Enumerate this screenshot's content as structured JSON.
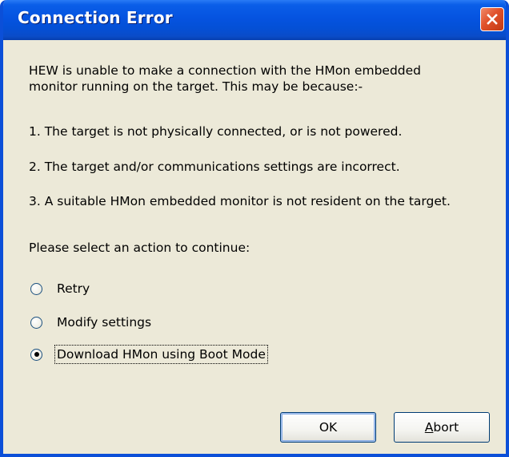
{
  "window": {
    "title": "Connection Error",
    "close_icon": "close-icon"
  },
  "message": {
    "intro_line1": "HEW is unable to make a connection with the HMon embedded",
    "intro_line2": "monitor running on the target. This may be because:-",
    "reason1": "1.  The target is not physically connected, or is not powered.",
    "reason2": "2.  The target and/or communications settings are incorrect.",
    "reason3": "3.  A suitable HMon embedded monitor is not resident on the target.",
    "prompt": "Please select an action to continue:"
  },
  "options": [
    {
      "label": "Retry",
      "checked": false
    },
    {
      "label": "Modify settings",
      "checked": false
    },
    {
      "label": "Download HMon using Boot Mode",
      "checked": true
    }
  ],
  "buttons": {
    "ok_label": "OK",
    "abort_first": "A",
    "abort_rest": "bort"
  },
  "colors": {
    "title_bar": "#0553e0",
    "dialog_bg": "#ece9d8",
    "close_button": "#e0502a"
  }
}
